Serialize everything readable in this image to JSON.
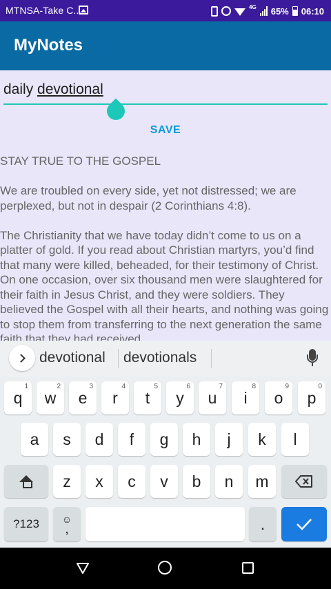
{
  "status_bar": {
    "carrier": "MTNSA-Take C...",
    "network": "4G",
    "battery": "65%",
    "time": "06:10",
    "icons": [
      "image-icon",
      "vibrate-icon",
      "alarm-icon",
      "wifi-icon",
      "signal-icon",
      "battery-icon"
    ]
  },
  "app_bar": {
    "title": "MyNotes"
  },
  "note": {
    "title_prefix": "daily ",
    "title_word": "devotional",
    "save_label": "SAVE",
    "paragraphs": [
      "STAY TRUE TO THE GOSPEL",
      "We are troubled on every side, yet not distressed; we are perplexed, but not in despair (2 Corinthians 4:8).",
      "The Christianity that we have today didn’t come to us on a platter of gold. If you read about Christian martyrs, you’d find that many were killed, beheaded, for their testimony of Christ. On one occasion, over six thousand men were slaughtered for their faith in Jesus Christ, and they were soldiers. They believed the Gospel with all their hearts, and nothing was going to stop them from transferring to the next generation the same faith that they had received."
    ]
  },
  "suggestions": [
    "devotional",
    "devotionals"
  ],
  "keyboard": {
    "row1": [
      {
        "k": "q",
        "h": "1"
      },
      {
        "k": "w",
        "h": "2"
      },
      {
        "k": "e",
        "h": "3"
      },
      {
        "k": "r",
        "h": "4"
      },
      {
        "k": "t",
        "h": "5"
      },
      {
        "k": "y",
        "h": "6"
      },
      {
        "k": "u",
        "h": "7"
      },
      {
        "k": "i",
        "h": "8"
      },
      {
        "k": "o",
        "h": "9"
      },
      {
        "k": "p",
        "h": "0"
      }
    ],
    "row2": [
      "a",
      "s",
      "d",
      "f",
      "g",
      "h",
      "j",
      "k",
      "l"
    ],
    "row3": [
      "z",
      "x",
      "c",
      "v",
      "b",
      "n",
      "m"
    ],
    "symbols_label": "?123",
    "emoji_glyph": "☺",
    "comma": ",",
    "period": "."
  },
  "colors": {
    "status_bar": "#3b1b9b",
    "app_bar": "#0a6aa3",
    "accent": "#1ec8b8",
    "save_text": "#0a9ad8",
    "enter_key": "#1a7be0"
  }
}
